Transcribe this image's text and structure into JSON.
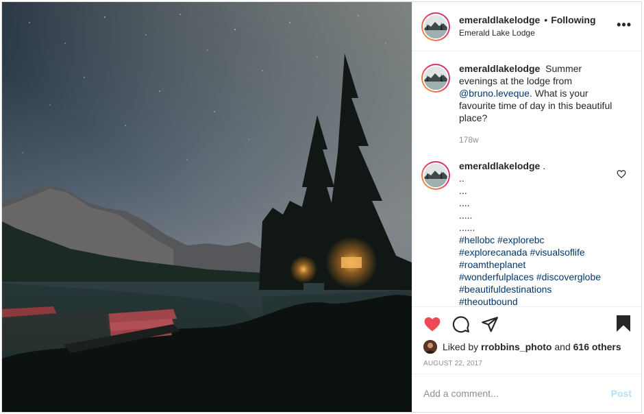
{
  "post": {
    "username": "emeraldlakelodge",
    "follow_separator": "•",
    "follow_status": "Following",
    "location": "Emerald Lake Lodge",
    "more_icon": "more-options-icon",
    "more_label": "•••"
  },
  "caption": {
    "username": "emeraldlakelodge",
    "text_before": " Summer evenings at the lodge from ",
    "mention": "@bruno.leveque",
    "text_after": ". What is your favourite time of day in this beautiful place?",
    "time": "178w"
  },
  "comment": {
    "username": "emeraldlakelodge",
    "first": ".",
    "lines": [
      "..",
      "...",
      "....",
      ".....",
      "......"
    ],
    "hashtag_lines": [
      [
        "#hellobc",
        "#explorebc"
      ],
      [
        "#explorecanada",
        "#visualsoflife"
      ],
      [
        "#roamtheplanet"
      ],
      [
        "#wonderfulplaces",
        "#discoverglobe"
      ],
      [
        "#beautifuldestinations"
      ],
      [
        "#theoutbound"
      ]
    ]
  },
  "actions": {
    "like_icon": "heart-filled-icon",
    "comment_icon": "comment-bubble-icon",
    "share_icon": "paper-plane-icon",
    "save_icon": "bookmark-filled-icon",
    "like_color": "#ed4956"
  },
  "likes": {
    "prefix": "Liked by ",
    "user": "rrobbins_photo",
    "middle": " and ",
    "others": "616 others"
  },
  "date": "AUGUST 22, 2017",
  "comment_box": {
    "placeholder": "Add a comment...",
    "post_label": "Post"
  }
}
